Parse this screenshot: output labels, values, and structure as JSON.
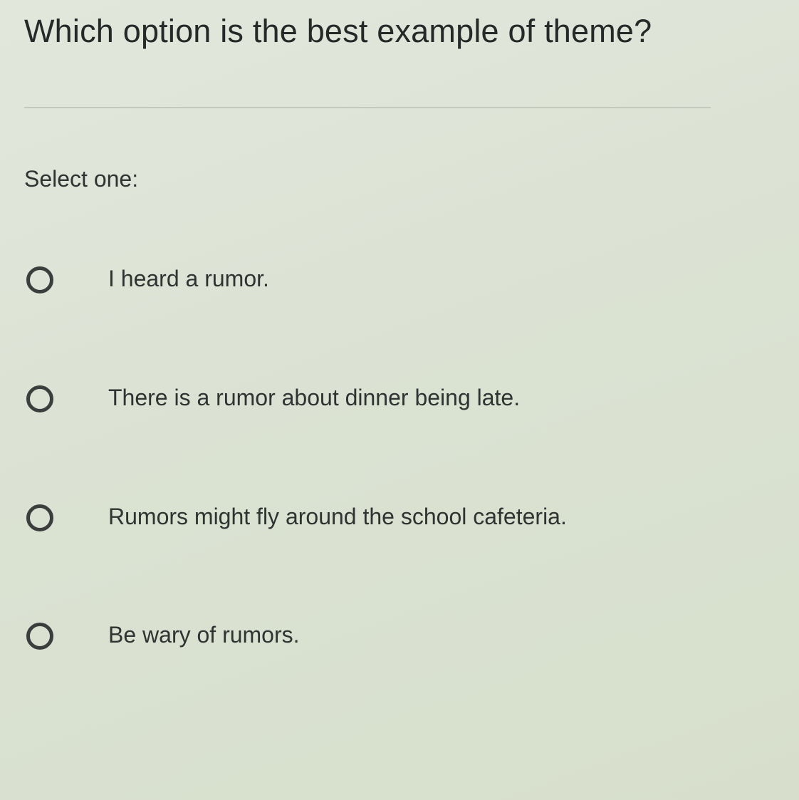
{
  "question": {
    "text": "Which option is the best example of theme?"
  },
  "prompt": "Select one:",
  "options": [
    {
      "label": "I heard a rumor.",
      "selected": false
    },
    {
      "label": "There is a rumor about dinner being late.",
      "selected": false
    },
    {
      "label": "Rumors might fly around the school cafeteria.",
      "selected": false
    },
    {
      "label": "Be wary of rumors.",
      "selected": false
    }
  ],
  "colors": {
    "background": "#dbe2d3",
    "text": "#2e3130",
    "radio_border": "#3b3e3d",
    "divider": "#c3c9bd"
  },
  "icons": {
    "radio": "radio-unchecked-icon"
  }
}
